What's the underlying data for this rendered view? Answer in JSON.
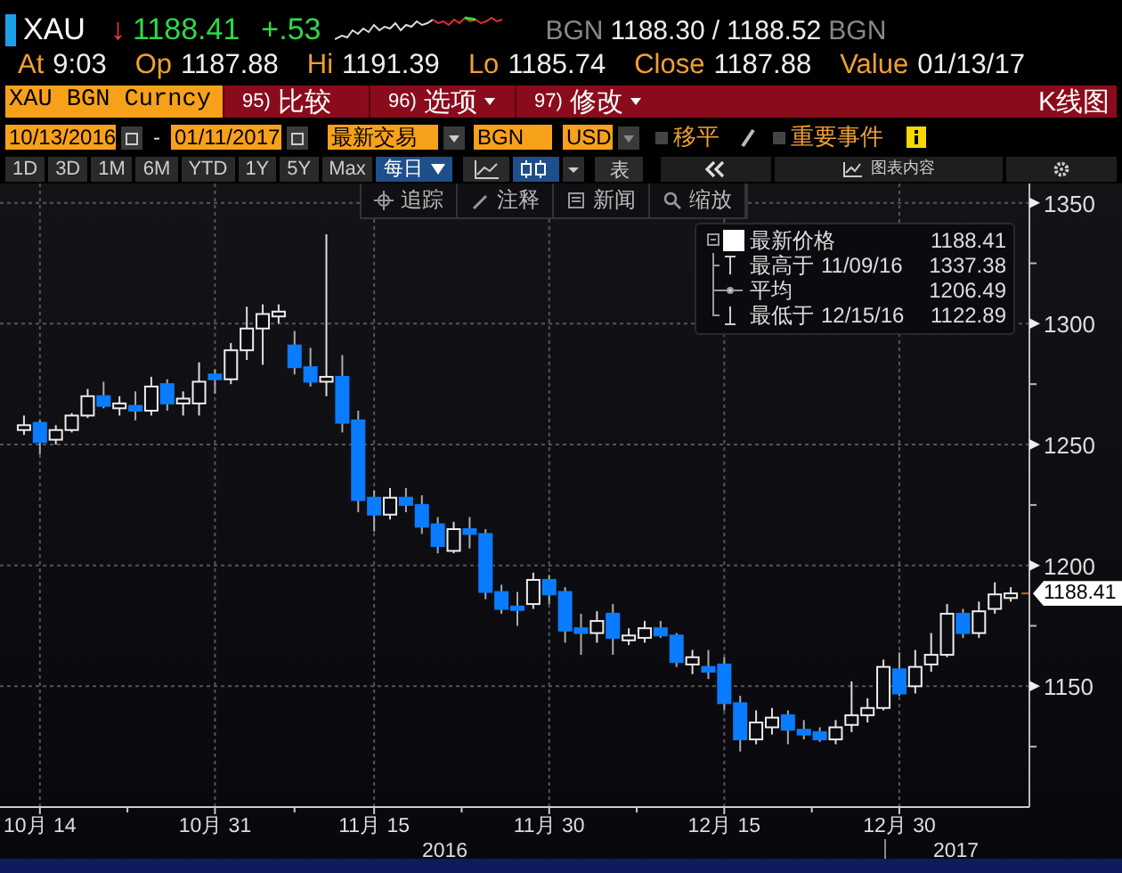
{
  "quote": {
    "ticker": "XAU",
    "arrow": "↓",
    "last": "1188.41",
    "change": "+.53",
    "source": "BGN",
    "bid": "1188.30",
    "separator": "/",
    "ask": "1188.52",
    "source_2": "BGN"
  },
  "stats": [
    {
      "label": "At",
      "value": "9:03"
    },
    {
      "label": "Op",
      "value": "1187.88"
    },
    {
      "label": "Hi",
      "value": "1191.39"
    },
    {
      "label": "Lo",
      "value": "1185.74"
    },
    {
      "label": "Close",
      "value": "1187.88"
    },
    {
      "label": "Value",
      "value": "01/13/17"
    }
  ],
  "command_bar": {
    "security": "XAU BGN Curncy",
    "menus": [
      {
        "number": "95)",
        "label": "比较",
        "dropdown": false
      },
      {
        "number": "96)",
        "label": "选项",
        "dropdown": true
      },
      {
        "number": "97)",
        "label": "修改",
        "dropdown": true
      }
    ],
    "title": "K线图"
  },
  "settings": {
    "start_date": "10/13/2016",
    "dash": "-",
    "end_date": "01/11/2017",
    "market": "最新交易",
    "pricing_source": "BGN",
    "currency": "USD",
    "options": [
      {
        "label": "移平",
        "checked": false
      },
      {
        "label": "重要事件",
        "checked": false
      }
    ]
  },
  "periods": [
    {
      "label": "1D",
      "selected": false
    },
    {
      "label": "3D",
      "selected": false
    },
    {
      "label": "1M",
      "selected": false
    },
    {
      "label": "6M",
      "selected": false
    },
    {
      "label": "YTD",
      "selected": false
    },
    {
      "label": "1Y",
      "selected": false
    },
    {
      "label": "5Y",
      "selected": false
    },
    {
      "label": "Max",
      "selected": false
    }
  ],
  "frequency": "每日",
  "table_button": "表",
  "chart_contents": "图表内容",
  "chart_tools": [
    {
      "kind": "track",
      "label": "追踪"
    },
    {
      "kind": "annotate",
      "label": "注释"
    },
    {
      "kind": "news",
      "label": "新闻"
    },
    {
      "kind": "zoom",
      "label": "缩放"
    }
  ],
  "legend": [
    {
      "kind": "last",
      "label": "最新价格",
      "value": "1188.41"
    },
    {
      "kind": "high",
      "label": "最高于",
      "date": "11/09/16",
      "value": "1337.38"
    },
    {
      "kind": "average",
      "label": "平均",
      "value": "1206.49"
    },
    {
      "kind": "low",
      "label": "最低于",
      "date": "12/15/16",
      "value": "1122.89"
    }
  ],
  "year_labels": [
    "2016",
    "2017"
  ],
  "last_price_tag": "1188.41",
  "chart_data": {
    "type": "candlestick",
    "grid": true,
    "ylim": [
      1100,
      1358
    ],
    "yticks": [
      1150,
      1200,
      1250,
      1300,
      1350
    ],
    "categories": [
      null,
      "10月 14",
      null,
      null,
      null,
      null,
      null,
      null,
      null,
      null,
      null,
      null,
      "10月 31",
      null,
      null,
      null,
      null,
      null,
      null,
      null,
      null,
      null,
      "11月 15",
      null,
      null,
      null,
      null,
      null,
      null,
      null,
      null,
      null,
      null,
      "11月 30",
      null,
      null,
      null,
      null,
      null,
      null,
      null,
      null,
      null,
      null,
      "12月 15",
      null,
      null,
      null,
      null,
      null,
      null,
      null,
      null,
      null,
      null,
      "12月 30",
      null,
      null,
      null,
      null,
      null,
      null,
      null
    ],
    "series": [
      {
        "ohlc": [
          [
            1256,
            1262,
            1254,
            1258
          ],
          [
            1259,
            1260,
            1246,
            1251
          ],
          [
            1252,
            1258,
            1250,
            1256
          ],
          [
            1256,
            1263,
            1255,
            1262
          ],
          [
            1262,
            1273,
            1261,
            1270
          ],
          [
            1270,
            1276,
            1265,
            1266
          ],
          [
            1265,
            1270,
            1262,
            1267
          ],
          [
            1266,
            1272,
            1260,
            1264
          ],
          [
            1264,
            1278,
            1262,
            1274
          ],
          [
            1275,
            1277,
            1264,
            1267
          ],
          [
            1267,
            1272,
            1262,
            1269
          ],
          [
            1267,
            1284,
            1262,
            1276
          ],
          [
            1279,
            1281,
            1271,
            1277
          ],
          [
            1277,
            1292,
            1275,
            1289
          ],
          [
            1289,
            1307,
            1285,
            1298
          ],
          [
            1298,
            1308,
            1283,
            1304
          ],
          [
            1303,
            1308,
            1300,
            1305
          ],
          [
            1291,
            1297,
            1279,
            1282
          ],
          [
            1282,
            1290,
            1274,
            1276
          ],
          [
            1276,
            1337,
            1270,
            1278
          ],
          [
            1278,
            1287,
            1255,
            1259
          ],
          [
            1260,
            1264,
            1222,
            1227
          ],
          [
            1228,
            1231,
            1214,
            1221
          ],
          [
            1221,
            1232,
            1219,
            1228
          ],
          [
            1228,
            1232,
            1222,
            1225
          ],
          [
            1225,
            1229,
            1213,
            1216
          ],
          [
            1217,
            1220,
            1205,
            1208
          ],
          [
            1206,
            1218,
            1205,
            1215
          ],
          [
            1215,
            1220,
            1207,
            1213
          ],
          [
            1213,
            1215,
            1186,
            1189
          ],
          [
            1189,
            1192,
            1180,
            1182
          ],
          [
            1183,
            1189,
            1175,
            1182
          ],
          [
            1184,
            1197,
            1182,
            1194
          ],
          [
            1194,
            1196,
            1184,
            1188
          ],
          [
            1189,
            1191,
            1168,
            1173
          ],
          [
            1174,
            1180,
            1163,
            1172
          ],
          [
            1172,
            1181,
            1168,
            1177
          ],
          [
            1180,
            1184,
            1163,
            1170
          ],
          [
            1169,
            1174,
            1167,
            1171
          ],
          [
            1170,
            1177,
            1168,
            1174
          ],
          [
            1174,
            1177,
            1170,
            1171
          ],
          [
            1171,
            1172,
            1158,
            1160
          ],
          [
            1159,
            1165,
            1155,
            1162
          ],
          [
            1158,
            1165,
            1153,
            1156
          ],
          [
            1159,
            1162,
            1140,
            1143
          ],
          [
            1143,
            1146,
            1123,
            1128
          ],
          [
            1128,
            1140,
            1126,
            1135
          ],
          [
            1133,
            1141,
            1130,
            1137
          ],
          [
            1138,
            1140,
            1126,
            1132
          ],
          [
            1132,
            1136,
            1128,
            1130
          ],
          [
            1131,
            1133,
            1127,
            1128
          ],
          [
            1128,
            1136,
            1126,
            1133
          ],
          [
            1134,
            1152,
            1131,
            1138
          ],
          [
            1138,
            1145,
            1135,
            1141
          ],
          [
            1141,
            1161,
            1140,
            1158
          ],
          [
            1157,
            1164,
            1146,
            1147
          ],
          [
            1150,
            1165,
            1147,
            1158
          ],
          [
            1159,
            1172,
            1156,
            1163
          ],
          [
            1163,
            1184,
            1162,
            1180
          ],
          [
            1180,
            1182,
            1170,
            1172
          ],
          [
            1172,
            1185,
            1170,
            1181
          ],
          [
            1182,
            1193,
            1180,
            1188
          ],
          [
            1186.5,
            1191,
            1185,
            1188.41
          ]
        ]
      }
    ]
  }
}
